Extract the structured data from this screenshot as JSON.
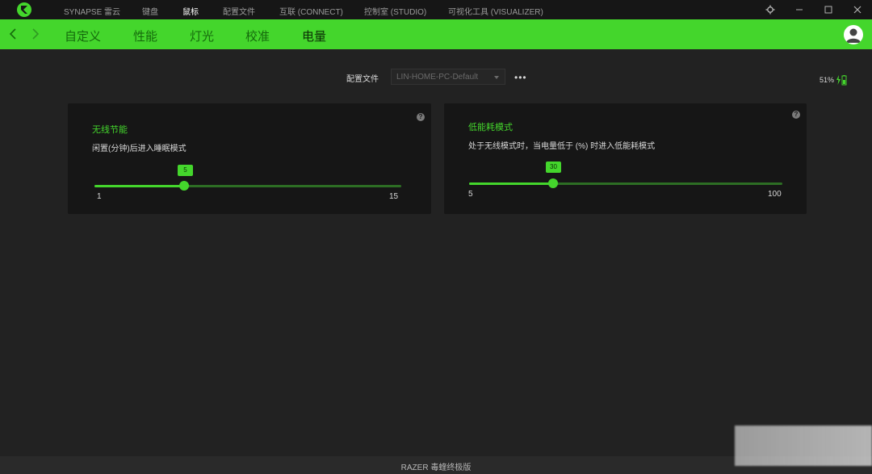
{
  "topbar": {
    "menu": [
      {
        "label": "SYNAPSE 雷云",
        "active": false
      },
      {
        "label": "键盘",
        "active": false
      },
      {
        "label": "鼠标",
        "active": true
      },
      {
        "label": "配置文件",
        "active": false
      },
      {
        "label": "互联 (CONNECT)",
        "active": false
      },
      {
        "label": "控制室 (STUDIO)",
        "active": false
      },
      {
        "label": "可视化工具 (VISUALIZER)",
        "active": false
      }
    ],
    "icons": [
      "razer-logo-icon",
      "settings-icon",
      "minimize-icon",
      "maximize-icon",
      "close-icon"
    ]
  },
  "nav": {
    "tabs": [
      "自定义",
      "性能",
      "灯光",
      "校准",
      "电量"
    ],
    "active_tab": "电量",
    "accent_color": "#44d62c"
  },
  "profile": {
    "label": "配置文件",
    "value": "LIN-HOME-PC-Default",
    "more_label": "•••"
  },
  "battery": {
    "percent_label": "51%",
    "level": 0.51
  },
  "card_wireless": {
    "title": "无线节能",
    "description": "闲置(分钟)后进入睡眠模式",
    "value": "5",
    "min": "1",
    "max": "15",
    "help": "?"
  },
  "card_lowpower": {
    "title": "低能耗模式",
    "description": "处于无线模式时，当电量低于 (%) 时进入低能耗模式",
    "value": "30",
    "min": "5",
    "max": "100",
    "help": "?"
  },
  "footer": {
    "device_name": "RAZER 毒蝰终极版"
  }
}
